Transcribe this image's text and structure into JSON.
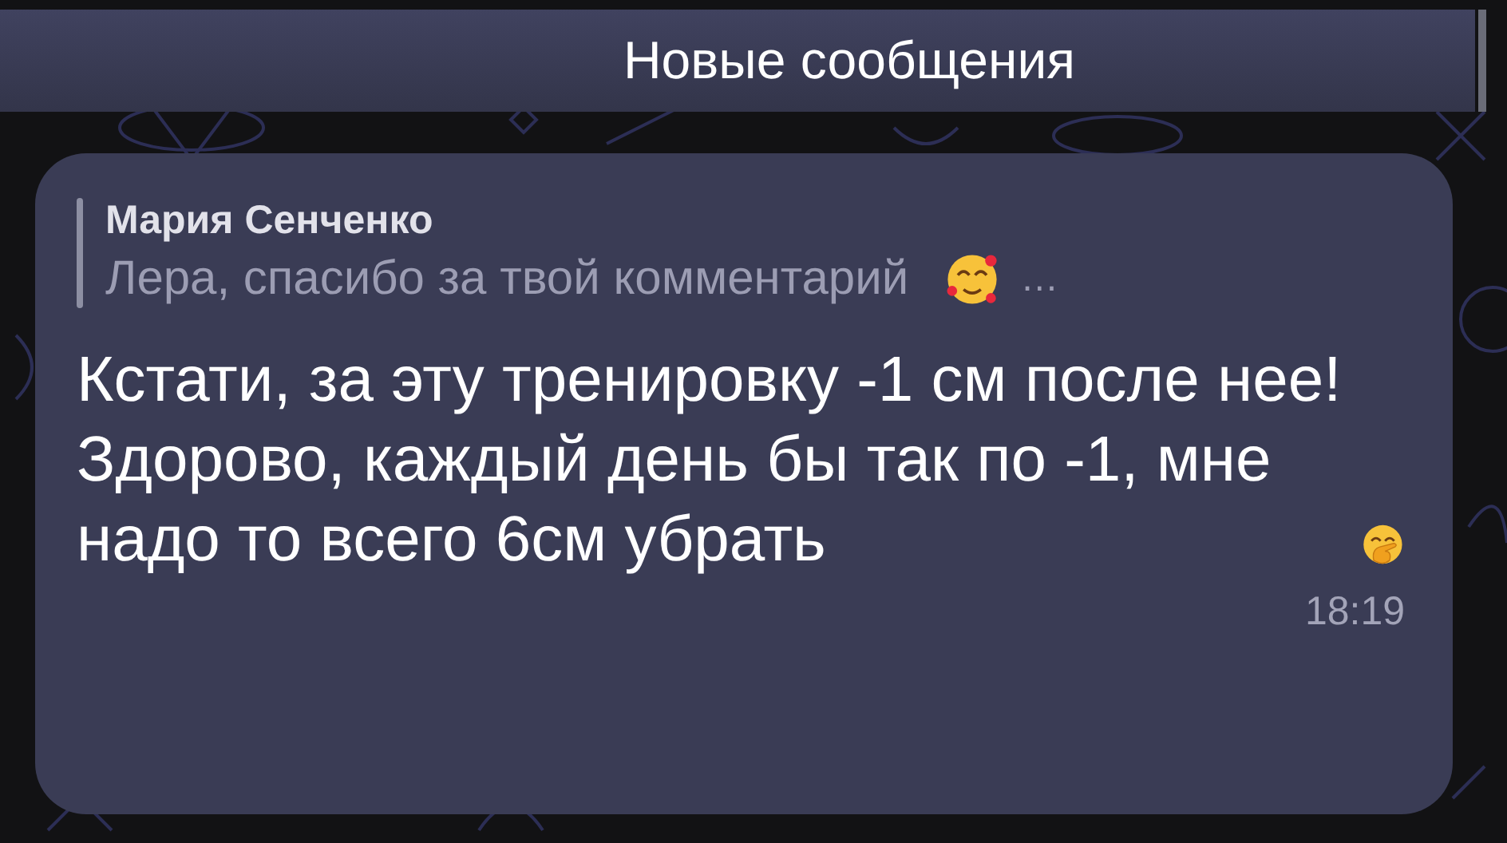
{
  "header": {
    "title": "Новые сообщения"
  },
  "message": {
    "reply": {
      "author": "Мария Сенченко",
      "text": "Лера, спасибо за твой комментарий",
      "ellipsis": "…"
    },
    "paragraphs": [
      "Кстати, за эту тренировку -1 см после нее!",
      "Здорово, каждый день бы так по -1, мне надо то всего 6см убрать"
    ],
    "time": "18:19"
  }
}
